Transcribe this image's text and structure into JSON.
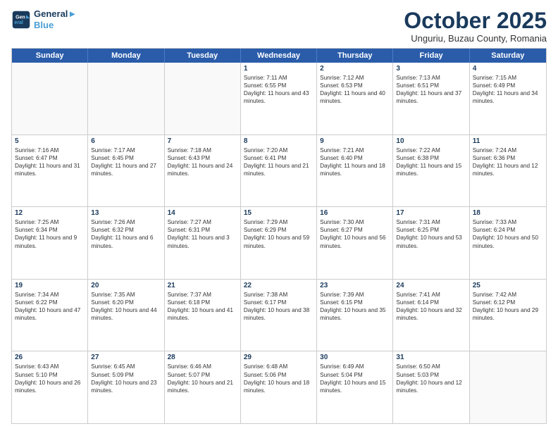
{
  "logo": {
    "line1": "General",
    "line2": "Blue"
  },
  "title": "October 2025",
  "subtitle": "Unguriu, Buzau County, Romania",
  "days_of_week": [
    "Sunday",
    "Monday",
    "Tuesday",
    "Wednesday",
    "Thursday",
    "Friday",
    "Saturday"
  ],
  "weeks": [
    [
      {
        "day": "",
        "empty": true
      },
      {
        "day": "",
        "empty": true
      },
      {
        "day": "",
        "empty": true
      },
      {
        "day": "1",
        "rise": "7:11 AM",
        "set": "6:55 PM",
        "dl": "11 hours and 43 minutes."
      },
      {
        "day": "2",
        "rise": "7:12 AM",
        "set": "6:53 PM",
        "dl": "11 hours and 40 minutes."
      },
      {
        "day": "3",
        "rise": "7:13 AM",
        "set": "6:51 PM",
        "dl": "11 hours and 37 minutes."
      },
      {
        "day": "4",
        "rise": "7:15 AM",
        "set": "6:49 PM",
        "dl": "11 hours and 34 minutes."
      }
    ],
    [
      {
        "day": "5",
        "rise": "7:16 AM",
        "set": "6:47 PM",
        "dl": "11 hours and 31 minutes."
      },
      {
        "day": "6",
        "rise": "7:17 AM",
        "set": "6:45 PM",
        "dl": "11 hours and 27 minutes."
      },
      {
        "day": "7",
        "rise": "7:18 AM",
        "set": "6:43 PM",
        "dl": "11 hours and 24 minutes."
      },
      {
        "day": "8",
        "rise": "7:20 AM",
        "set": "6:41 PM",
        "dl": "11 hours and 21 minutes."
      },
      {
        "day": "9",
        "rise": "7:21 AM",
        "set": "6:40 PM",
        "dl": "11 hours and 18 minutes."
      },
      {
        "day": "10",
        "rise": "7:22 AM",
        "set": "6:38 PM",
        "dl": "11 hours and 15 minutes."
      },
      {
        "day": "11",
        "rise": "7:24 AM",
        "set": "6:36 PM",
        "dl": "11 hours and 12 minutes."
      }
    ],
    [
      {
        "day": "12",
        "rise": "7:25 AM",
        "set": "6:34 PM",
        "dl": "11 hours and 9 minutes."
      },
      {
        "day": "13",
        "rise": "7:26 AM",
        "set": "6:32 PM",
        "dl": "11 hours and 6 minutes."
      },
      {
        "day": "14",
        "rise": "7:27 AM",
        "set": "6:31 PM",
        "dl": "11 hours and 3 minutes."
      },
      {
        "day": "15",
        "rise": "7:29 AM",
        "set": "6:29 PM",
        "dl": "10 hours and 59 minutes."
      },
      {
        "day": "16",
        "rise": "7:30 AM",
        "set": "6:27 PM",
        "dl": "10 hours and 56 minutes."
      },
      {
        "day": "17",
        "rise": "7:31 AM",
        "set": "6:25 PM",
        "dl": "10 hours and 53 minutes."
      },
      {
        "day": "18",
        "rise": "7:33 AM",
        "set": "6:24 PM",
        "dl": "10 hours and 50 minutes."
      }
    ],
    [
      {
        "day": "19",
        "rise": "7:34 AM",
        "set": "6:22 PM",
        "dl": "10 hours and 47 minutes."
      },
      {
        "day": "20",
        "rise": "7:35 AM",
        "set": "6:20 PM",
        "dl": "10 hours and 44 minutes."
      },
      {
        "day": "21",
        "rise": "7:37 AM",
        "set": "6:18 PM",
        "dl": "10 hours and 41 minutes."
      },
      {
        "day": "22",
        "rise": "7:38 AM",
        "set": "6:17 PM",
        "dl": "10 hours and 38 minutes."
      },
      {
        "day": "23",
        "rise": "7:39 AM",
        "set": "6:15 PM",
        "dl": "10 hours and 35 minutes."
      },
      {
        "day": "24",
        "rise": "7:41 AM",
        "set": "6:14 PM",
        "dl": "10 hours and 32 minutes."
      },
      {
        "day": "25",
        "rise": "7:42 AM",
        "set": "6:12 PM",
        "dl": "10 hours and 29 minutes."
      }
    ],
    [
      {
        "day": "26",
        "rise": "6:43 AM",
        "set": "5:10 PM",
        "dl": "10 hours and 26 minutes."
      },
      {
        "day": "27",
        "rise": "6:45 AM",
        "set": "5:09 PM",
        "dl": "10 hours and 23 minutes."
      },
      {
        "day": "28",
        "rise": "6:46 AM",
        "set": "5:07 PM",
        "dl": "10 hours and 21 minutes."
      },
      {
        "day": "29",
        "rise": "6:48 AM",
        "set": "5:06 PM",
        "dl": "10 hours and 18 minutes."
      },
      {
        "day": "30",
        "rise": "6:49 AM",
        "set": "5:04 PM",
        "dl": "10 hours and 15 minutes."
      },
      {
        "day": "31",
        "rise": "6:50 AM",
        "set": "5:03 PM",
        "dl": "10 hours and 12 minutes."
      },
      {
        "day": "",
        "empty": true
      }
    ]
  ]
}
